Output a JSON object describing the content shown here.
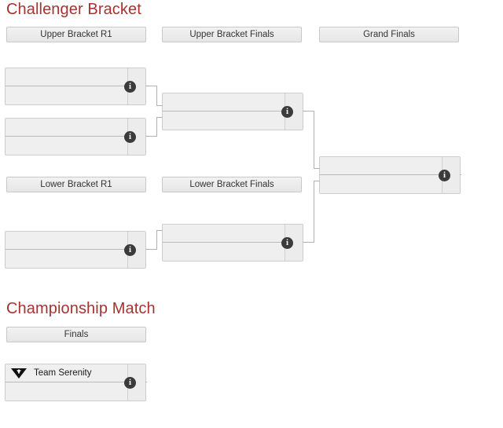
{
  "sections": [
    {
      "id": "challenger",
      "title": "Challenger Bracket"
    },
    {
      "id": "championship",
      "title": "Championship Match"
    }
  ],
  "colors": {
    "heading": "#a63232",
    "header_pill_bg": "#ececec",
    "header_pill_border": "#c8c8c8",
    "match_bg": "#efefef",
    "match_border": "#cccccc",
    "connector": "#b0b0b0",
    "info_badge_bg": "#3b3b3b",
    "team_text": "#1a1a1a"
  },
  "challenger": {
    "round_headers": [
      {
        "label": "Upper Bracket R1"
      },
      {
        "label": "Upper Bracket Finals"
      },
      {
        "label": "Grand Finals"
      },
      {
        "label": "Lower Bracket R1"
      },
      {
        "label": "Lower Bracket Finals"
      }
    ],
    "matches": [
      {
        "name": "upper-bracket-r1-match-1",
        "round": "Upper Bracket R1",
        "teams": [
          {
            "name": "",
            "logo": "",
            "score": ""
          },
          {
            "name": "",
            "logo": "",
            "score": ""
          }
        ],
        "info_label": "i"
      },
      {
        "name": "upper-bracket-r1-match-2",
        "round": "Upper Bracket R1",
        "teams": [
          {
            "name": "",
            "logo": "",
            "score": ""
          },
          {
            "name": "",
            "logo": "",
            "score": ""
          }
        ],
        "info_label": "i"
      },
      {
        "name": "upper-bracket-finals-match",
        "round": "Upper Bracket Finals",
        "teams": [
          {
            "name": "",
            "logo": "",
            "score": ""
          },
          {
            "name": "",
            "logo": "",
            "score": ""
          }
        ],
        "info_label": "i"
      },
      {
        "name": "grand-finals-match",
        "round": "Grand Finals",
        "teams": [
          {
            "name": "",
            "logo": "",
            "score": ""
          },
          {
            "name": "",
            "logo": "",
            "score": ""
          }
        ],
        "info_label": "i"
      },
      {
        "name": "lower-bracket-r1-match",
        "round": "Lower Bracket R1",
        "teams": [
          {
            "name": "",
            "logo": "",
            "score": ""
          },
          {
            "name": "",
            "logo": "",
            "score": ""
          }
        ],
        "info_label": "i"
      },
      {
        "name": "lower-bracket-finals-match",
        "round": "Lower Bracket Finals",
        "teams": [
          {
            "name": "",
            "logo": "",
            "score": ""
          },
          {
            "name": "",
            "logo": "",
            "score": ""
          }
        ],
        "info_label": "i"
      }
    ]
  },
  "championship": {
    "round_headers": [
      {
        "label": "Finals"
      }
    ],
    "matches": [
      {
        "name": "championship-finals-match",
        "round": "Finals",
        "teams": [
          {
            "name": "Team Serenity",
            "logo": "team-serenity-logo",
            "score": ""
          },
          {
            "name": "",
            "logo": "",
            "score": ""
          }
        ],
        "info_label": "i"
      }
    ]
  }
}
